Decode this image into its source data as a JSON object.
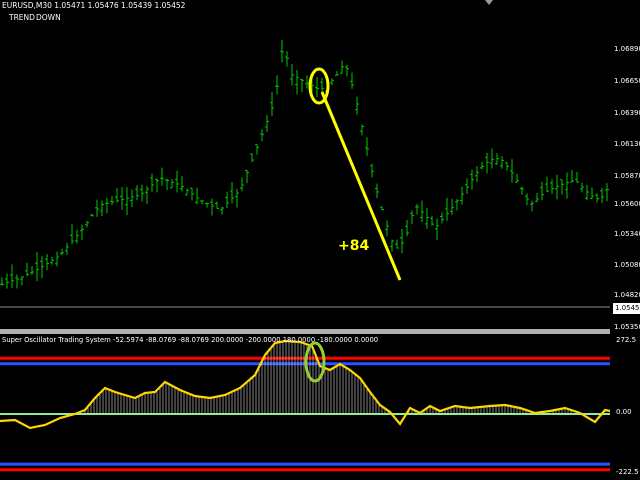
{
  "window": {
    "symbol_line": "EURUSD,M30  1.05471 1.05476 1.05439 1.05452",
    "trend_label": "TREND",
    "trend_value": "DOWN"
  },
  "price_axis": {
    "labels": [
      "1.06890",
      "1.06650",
      "1.06390",
      "1.06130",
      "1.05870",
      "1.05600",
      "1.05340",
      "1.05080",
      "1.04820"
    ],
    "current_price": "1.05452",
    "bottom_label": "1.05350"
  },
  "annotation": {
    "profit_text": "+84",
    "color": "#ffff00"
  },
  "oscillator": {
    "title": "Super Oscillator Trading System -52.5974 -88.0769 -88.0769 200.0000 -200.0000 180.0000 -180.0000 0.0000",
    "axis_labels": {
      "top": "272.5",
      "zero": "0.00",
      "bottom": "-222.5"
    },
    "levels": [
      {
        "name": "upper-red",
        "value": 200,
        "color": "#ff0000"
      },
      {
        "name": "upper-blue",
        "value": 180,
        "color": "#3050ff"
      },
      {
        "name": "zero",
        "value": 0,
        "color": "#90ee90"
      },
      {
        "name": "lower-blue",
        "value": -180,
        "color": "#3050ff"
      },
      {
        "name": "lower-red",
        "value": -200,
        "color": "#ff0000"
      }
    ],
    "line_color": "#ffd700",
    "marker_color": "#9acd32"
  },
  "colors": {
    "background": "#000000",
    "candles": "#00c800"
  },
  "scroll_marker": "chart-shift-marker-icon"
}
